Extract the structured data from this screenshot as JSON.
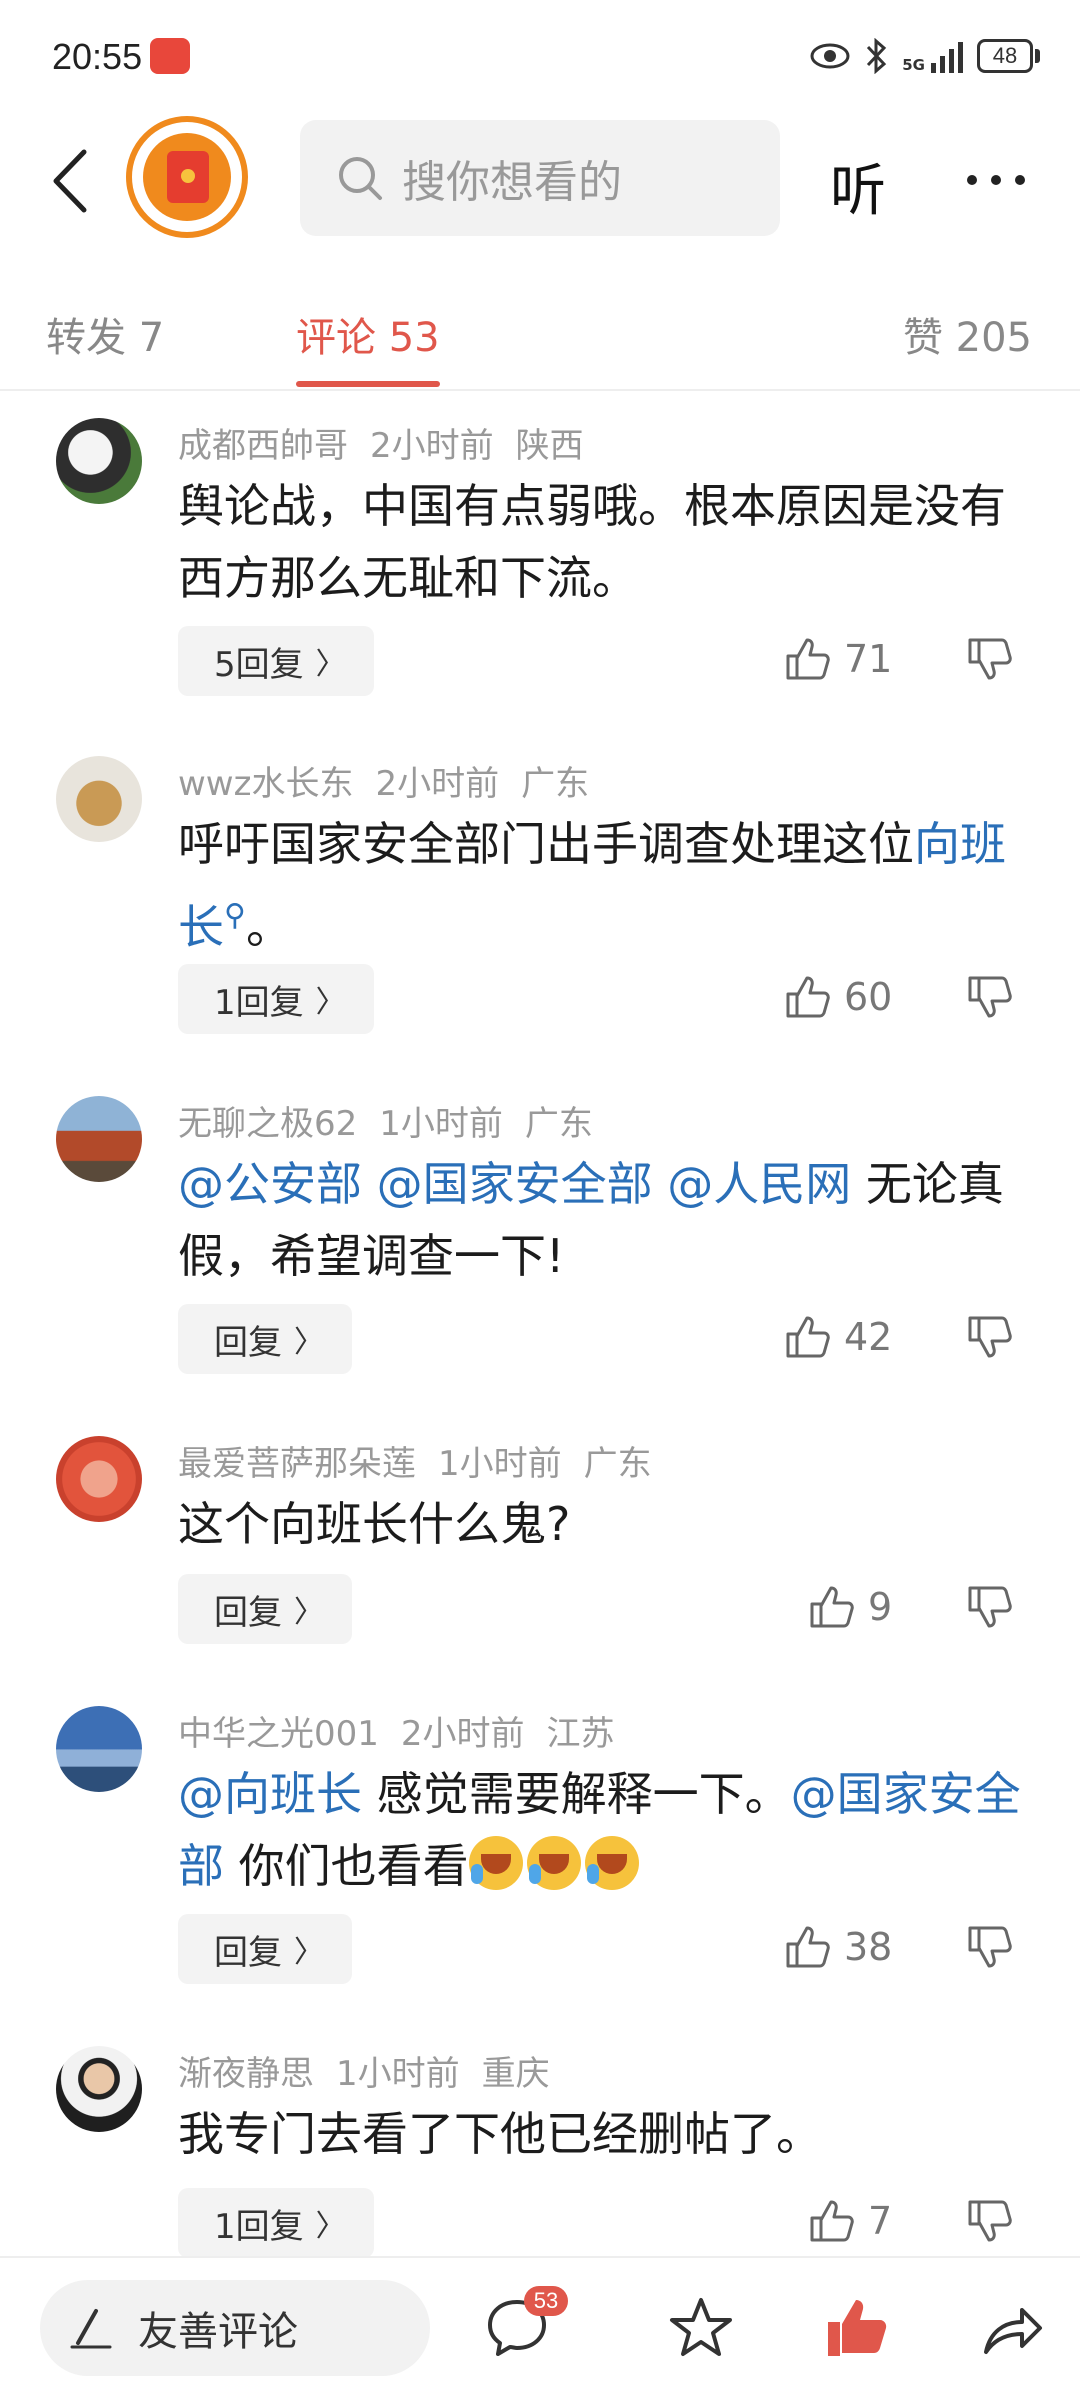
{
  "status_bar": {
    "time": "20:55",
    "network": "5G",
    "battery": "48"
  },
  "header": {
    "search_placeholder": "搜你想看的",
    "listen_label": "听"
  },
  "tabs": {
    "forward": "转发 7",
    "comments": "评论 53",
    "likes": "赞 205"
  },
  "comments": [
    {
      "user": "成都西帥哥",
      "time": "2小时前",
      "location": "陕西",
      "text": "舆论战，中国有点弱哦。根本原因是没有西方那么无耻和下流。",
      "reply_label": "5回复",
      "likes": "71"
    },
    {
      "user": "wwz水长东",
      "time": "2小时前",
      "location": "广东",
      "text_before": "呼吁国家安全部门出手调查处理这位",
      "mention": "向班长",
      "text_after": "。",
      "reply_label": "1回复",
      "likes": "60"
    },
    {
      "user": "无聊之极62",
      "time": "1小时前",
      "location": "广东",
      "mentions": [
        "@公安部",
        "@国家安全部",
        "@人民网"
      ],
      "text_after": "无论真假，希望调查一下!",
      "reply_label": "回复",
      "likes": "42"
    },
    {
      "user": "最爱菩萨那朵莲",
      "time": "1小时前",
      "location": "广东",
      "text": "这个向班长什么鬼?",
      "reply_label": "回复",
      "likes": "9"
    },
    {
      "user": "中华之光001",
      "time": "2小时前",
      "location": "江苏",
      "mention1": "@向班长",
      "text_mid": "感觉需要解释一下。",
      "mention2": "@国家安全部",
      "text_after": "你们也看看",
      "reply_label": "回复",
      "likes": "38"
    },
    {
      "user": "渐夜静思",
      "time": "1小时前",
      "location": "重庆",
      "text": "我专门去看了下他已经删帖了。",
      "reply_label": "1回复",
      "likes": "7"
    }
  ],
  "bottom_bar": {
    "input_label": "友善评论",
    "comment_count": "53"
  },
  "colors": {
    "accent": "#e0574b",
    "mention": "#2a6fb8",
    "meta": "#999999"
  },
  "icons": [
    "back-icon",
    "search-icon",
    "more-icon",
    "thumb-up-icon",
    "thumb-down-icon",
    "comment-bubble-icon",
    "star-icon",
    "like-filled-icon",
    "share-icon",
    "pen-icon"
  ]
}
